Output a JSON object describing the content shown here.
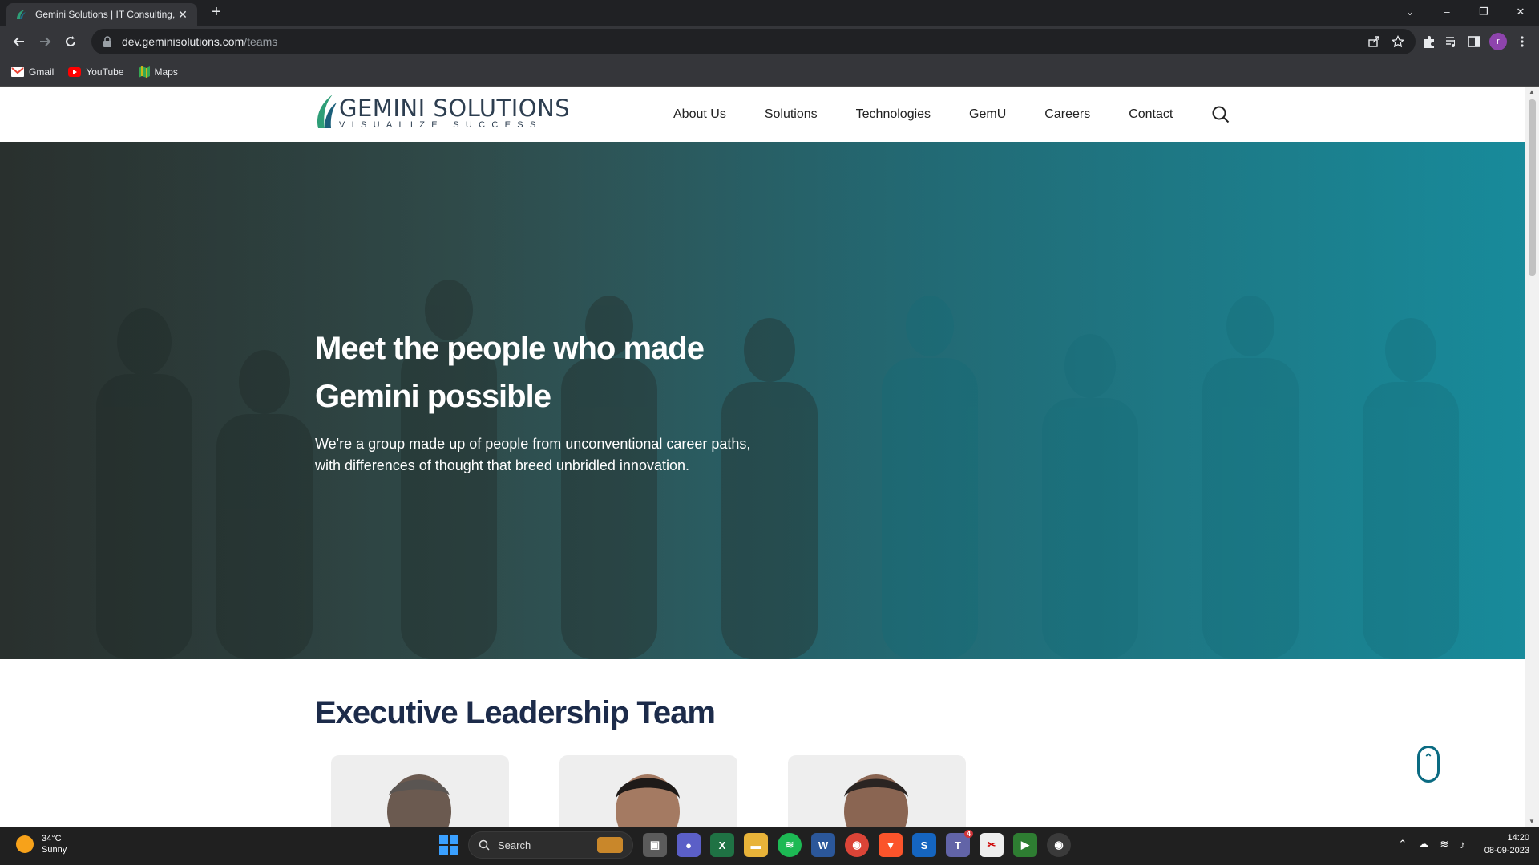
{
  "browser": {
    "tab_title": "Gemini Solutions | IT Consulting,",
    "new_tab": "+",
    "close_tab": "✕",
    "url_host": "dev.geminisolutions.com",
    "url_path": "/teams",
    "bookmarks": [
      {
        "label": "Gmail",
        "icon": "gmail-icon"
      },
      {
        "label": "YouTube",
        "icon": "youtube-icon"
      },
      {
        "label": "Maps",
        "icon": "maps-icon"
      }
    ],
    "profile_initial": "r",
    "window_controls": {
      "chevron": "⌄",
      "minimize": "–",
      "restore": "❐",
      "close": "✕"
    }
  },
  "site": {
    "logo_name": "GEMINI SOLUTIONS",
    "logo_tag": "VISUALIZE SUCCESS",
    "nav": [
      "About Us",
      "Solutions",
      "Technologies",
      "GemU",
      "Careers",
      "Contact"
    ],
    "hero": {
      "headline": "Meet the people who made Gemini possible",
      "sub": "We're a group made up of people from unconventional career paths, with differences of thought that breed unbridled innovation."
    },
    "section_title": "Executive Leadership Team",
    "scroll_top": "⌃"
  },
  "taskbar": {
    "weather_temp": "34°C",
    "weather_desc": "Sunny",
    "search_label": "Search",
    "time": "14:20",
    "date": "08-09-2023",
    "teams_badge": "4"
  },
  "colors": {
    "accent": "#0b6b82",
    "heading": "#1c2b4a"
  }
}
